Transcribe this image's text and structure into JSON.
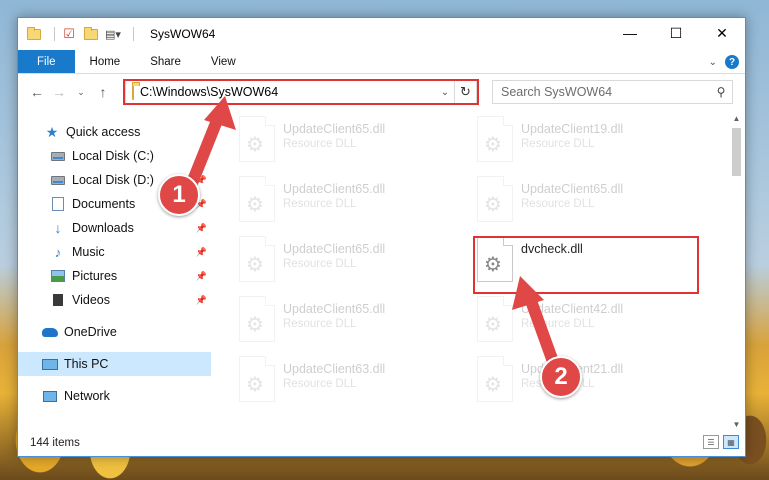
{
  "window": {
    "title": "SysWOW64",
    "controls": {
      "minimize": "—",
      "maximize": "☐",
      "close": "✕"
    }
  },
  "ribbon": {
    "tabs": [
      "File",
      "Home",
      "Share",
      "View"
    ]
  },
  "nav": {
    "address": "C:\\Windows\\SysWOW64",
    "search_placeholder": "Search SysWOW64"
  },
  "sidebar": {
    "items": [
      {
        "label": "Quick access",
        "icon": "star-icon"
      },
      {
        "label": "Local Disk (C:)",
        "icon": "drive-icon"
      },
      {
        "label": "Local Disk (D:)",
        "icon": "drive-icon"
      },
      {
        "label": "Documents",
        "icon": "documents-icon"
      },
      {
        "label": "Downloads",
        "icon": "download-icon"
      },
      {
        "label": "Music",
        "icon": "music-icon"
      },
      {
        "label": "Pictures",
        "icon": "pictures-icon"
      },
      {
        "label": "Videos",
        "icon": "videos-icon"
      },
      {
        "label": "OneDrive",
        "icon": "cloud-icon"
      },
      {
        "label": "This PC",
        "icon": "computer-icon"
      },
      {
        "label": "Network",
        "icon": "network-icon"
      }
    ]
  },
  "files": [
    {
      "name": "UpdateClient65.dll",
      "type": "Resource DLL"
    },
    {
      "name": "UpdateClient19.dll",
      "type": "Resource DLL"
    },
    {
      "name": "UpdateClient65.dll",
      "type": "Resource DLL"
    },
    {
      "name": "UpdateClient65.dll",
      "type": "Resource DLL"
    },
    {
      "name": "UpdateClient65.dll",
      "type": "Resource DLL"
    },
    {
      "name": "dvcheck.dll",
      "type": ""
    },
    {
      "name": "UpdateClient65.dll",
      "type": "Resource DLL"
    },
    {
      "name": "UpdateClient42.dll",
      "type": "Resource DLL"
    },
    {
      "name": "UpdateClient63.dll",
      "type": "Resource DLL"
    },
    {
      "name": "UpdateClient21.dll",
      "type": "Resource DLL"
    }
  ],
  "status": {
    "item_count": "144 items"
  },
  "callouts": {
    "step1": "1",
    "step2": "2"
  },
  "colors": {
    "accent": "#1979ca",
    "highlight": "#e03434",
    "callout": "#e04848",
    "selection": "#cce8ff"
  }
}
